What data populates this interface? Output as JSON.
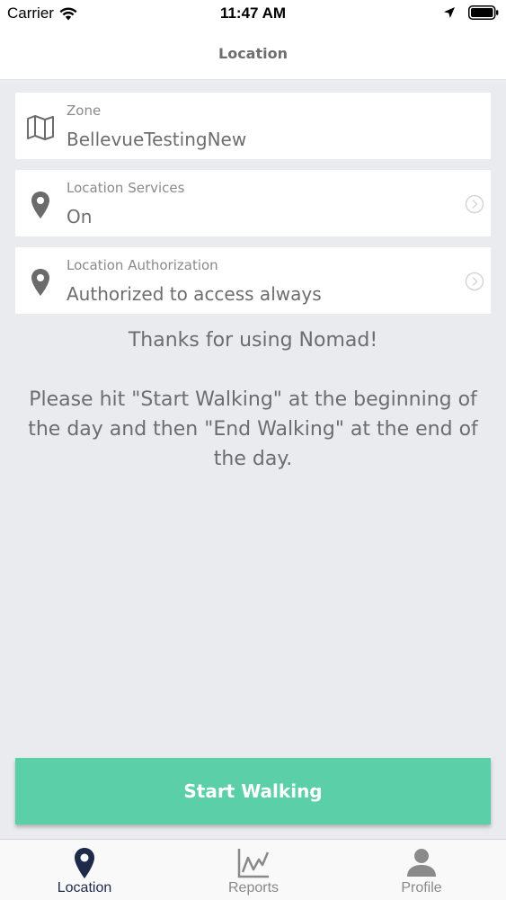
{
  "status_bar": {
    "carrier": "Carrier",
    "time": "11:47 AM"
  },
  "nav": {
    "title": "Location"
  },
  "cards": [
    {
      "label": "Zone",
      "value": "BellevueTestingNew",
      "icon": "map-icon"
    },
    {
      "label": "Location Services",
      "value": "On",
      "icon": "location-pin-icon"
    },
    {
      "label": "Location Authorization",
      "value": "Authorized to access always",
      "icon": "location-pin-icon"
    }
  ],
  "message": {
    "thanks": "Thanks for using Nomad!",
    "instructions": "Please hit \"Start Walking\" at the beginning of the day and then \"End Walking\" at the end of the day."
  },
  "start_button": {
    "label": "Start Walking"
  },
  "tabs": [
    {
      "label": "Location",
      "icon": "location-pin-icon",
      "active": true
    },
    {
      "label": "Reports",
      "icon": "chart-icon",
      "active": false
    },
    {
      "label": "Profile",
      "icon": "person-icon",
      "active": false
    }
  ],
  "colors": {
    "background": "#e9ebef",
    "accent": "#5bcfa8",
    "active_tab": "#1f2a4a",
    "inactive_tab": "#8a8a8a"
  }
}
